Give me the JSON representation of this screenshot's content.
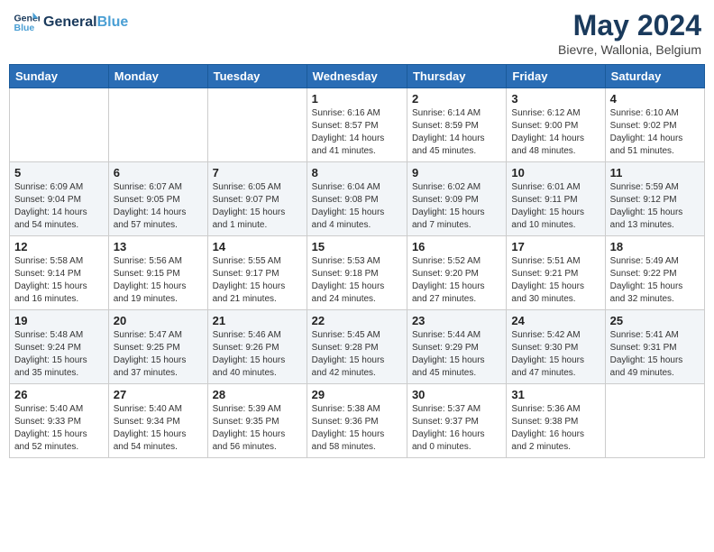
{
  "header": {
    "logo_line1": "General",
    "logo_line2": "Blue",
    "month": "May 2024",
    "location": "Bievre, Wallonia, Belgium"
  },
  "days_of_week": [
    "Sunday",
    "Monday",
    "Tuesday",
    "Wednesday",
    "Thursday",
    "Friday",
    "Saturday"
  ],
  "weeks": [
    [
      {
        "day": "",
        "info": ""
      },
      {
        "day": "",
        "info": ""
      },
      {
        "day": "",
        "info": ""
      },
      {
        "day": "1",
        "info": "Sunrise: 6:16 AM\nSunset: 8:57 PM\nDaylight: 14 hours\nand 41 minutes."
      },
      {
        "day": "2",
        "info": "Sunrise: 6:14 AM\nSunset: 8:59 PM\nDaylight: 14 hours\nand 45 minutes."
      },
      {
        "day": "3",
        "info": "Sunrise: 6:12 AM\nSunset: 9:00 PM\nDaylight: 14 hours\nand 48 minutes."
      },
      {
        "day": "4",
        "info": "Sunrise: 6:10 AM\nSunset: 9:02 PM\nDaylight: 14 hours\nand 51 minutes."
      }
    ],
    [
      {
        "day": "5",
        "info": "Sunrise: 6:09 AM\nSunset: 9:04 PM\nDaylight: 14 hours\nand 54 minutes."
      },
      {
        "day": "6",
        "info": "Sunrise: 6:07 AM\nSunset: 9:05 PM\nDaylight: 14 hours\nand 57 minutes."
      },
      {
        "day": "7",
        "info": "Sunrise: 6:05 AM\nSunset: 9:07 PM\nDaylight: 15 hours\nand 1 minute."
      },
      {
        "day": "8",
        "info": "Sunrise: 6:04 AM\nSunset: 9:08 PM\nDaylight: 15 hours\nand 4 minutes."
      },
      {
        "day": "9",
        "info": "Sunrise: 6:02 AM\nSunset: 9:09 PM\nDaylight: 15 hours\nand 7 minutes."
      },
      {
        "day": "10",
        "info": "Sunrise: 6:01 AM\nSunset: 9:11 PM\nDaylight: 15 hours\nand 10 minutes."
      },
      {
        "day": "11",
        "info": "Sunrise: 5:59 AM\nSunset: 9:12 PM\nDaylight: 15 hours\nand 13 minutes."
      }
    ],
    [
      {
        "day": "12",
        "info": "Sunrise: 5:58 AM\nSunset: 9:14 PM\nDaylight: 15 hours\nand 16 minutes."
      },
      {
        "day": "13",
        "info": "Sunrise: 5:56 AM\nSunset: 9:15 PM\nDaylight: 15 hours\nand 19 minutes."
      },
      {
        "day": "14",
        "info": "Sunrise: 5:55 AM\nSunset: 9:17 PM\nDaylight: 15 hours\nand 21 minutes."
      },
      {
        "day": "15",
        "info": "Sunrise: 5:53 AM\nSunset: 9:18 PM\nDaylight: 15 hours\nand 24 minutes."
      },
      {
        "day": "16",
        "info": "Sunrise: 5:52 AM\nSunset: 9:20 PM\nDaylight: 15 hours\nand 27 minutes."
      },
      {
        "day": "17",
        "info": "Sunrise: 5:51 AM\nSunset: 9:21 PM\nDaylight: 15 hours\nand 30 minutes."
      },
      {
        "day": "18",
        "info": "Sunrise: 5:49 AM\nSunset: 9:22 PM\nDaylight: 15 hours\nand 32 minutes."
      }
    ],
    [
      {
        "day": "19",
        "info": "Sunrise: 5:48 AM\nSunset: 9:24 PM\nDaylight: 15 hours\nand 35 minutes."
      },
      {
        "day": "20",
        "info": "Sunrise: 5:47 AM\nSunset: 9:25 PM\nDaylight: 15 hours\nand 37 minutes."
      },
      {
        "day": "21",
        "info": "Sunrise: 5:46 AM\nSunset: 9:26 PM\nDaylight: 15 hours\nand 40 minutes."
      },
      {
        "day": "22",
        "info": "Sunrise: 5:45 AM\nSunset: 9:28 PM\nDaylight: 15 hours\nand 42 minutes."
      },
      {
        "day": "23",
        "info": "Sunrise: 5:44 AM\nSunset: 9:29 PM\nDaylight: 15 hours\nand 45 minutes."
      },
      {
        "day": "24",
        "info": "Sunrise: 5:42 AM\nSunset: 9:30 PM\nDaylight: 15 hours\nand 47 minutes."
      },
      {
        "day": "25",
        "info": "Sunrise: 5:41 AM\nSunset: 9:31 PM\nDaylight: 15 hours\nand 49 minutes."
      }
    ],
    [
      {
        "day": "26",
        "info": "Sunrise: 5:40 AM\nSunset: 9:33 PM\nDaylight: 15 hours\nand 52 minutes."
      },
      {
        "day": "27",
        "info": "Sunrise: 5:40 AM\nSunset: 9:34 PM\nDaylight: 15 hours\nand 54 minutes."
      },
      {
        "day": "28",
        "info": "Sunrise: 5:39 AM\nSunset: 9:35 PM\nDaylight: 15 hours\nand 56 minutes."
      },
      {
        "day": "29",
        "info": "Sunrise: 5:38 AM\nSunset: 9:36 PM\nDaylight: 15 hours\nand 58 minutes."
      },
      {
        "day": "30",
        "info": "Sunrise: 5:37 AM\nSunset: 9:37 PM\nDaylight: 16 hours\nand 0 minutes."
      },
      {
        "day": "31",
        "info": "Sunrise: 5:36 AM\nSunset: 9:38 PM\nDaylight: 16 hours\nand 2 minutes."
      },
      {
        "day": "",
        "info": ""
      }
    ]
  ]
}
